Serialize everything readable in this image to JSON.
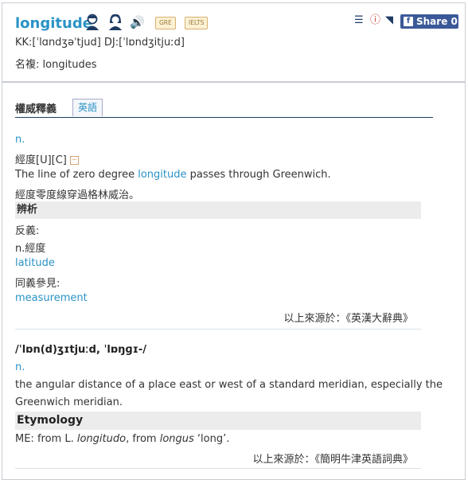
{
  "header": {
    "word": "longitude",
    "badges": [
      "GRE",
      "IELTS"
    ],
    "pron": "KK:[ˈlɑndʒəˈtjud] DJ:[ˈlɒndʒitjuːd]",
    "plural": "名複: longitudes",
    "share_label": "Share 0"
  },
  "tabs": {
    "main": "權威釋義",
    "sub": "英語"
  },
  "entry1": {
    "pos": "n.",
    "sense": "經度[U][C]",
    "toggle": "−",
    "example_pre": "The line of zero degree ",
    "example_word": "longitude",
    "example_post": " passes through Greenwich.",
    "translation": "經度零度線穿過格林威治。",
    "analysis_title": "辨析",
    "antonym_label": "反義:",
    "antonym_pos": "n.經度",
    "antonym_word": "latitude",
    "synonym_label": "同義參見:",
    "synonym_word": "measurement",
    "source": "以上來源於：《英漢大辭典》"
  },
  "entry2": {
    "pron_a": "/ˈlɒn(d)ʒɪtjuːd",
    "pron_sep": ", ",
    "pron_b": "ˈlɒŋɡɪ-/",
    "pos": "n.",
    "definition_line1": "the angular distance of a place east or west of a standard meridian, especially the",
    "definition_line2": "Greenwich meridian.",
    "etymology_title": "Etymology",
    "etym_pre": "ME: from L. ",
    "etym_word1": "longitudo",
    "etym_mid": ", from ",
    "etym_word2": "longus",
    "etym_post": " ‘long’.",
    "source": "以上來源於：《簡明牛津英語詞典》"
  }
}
